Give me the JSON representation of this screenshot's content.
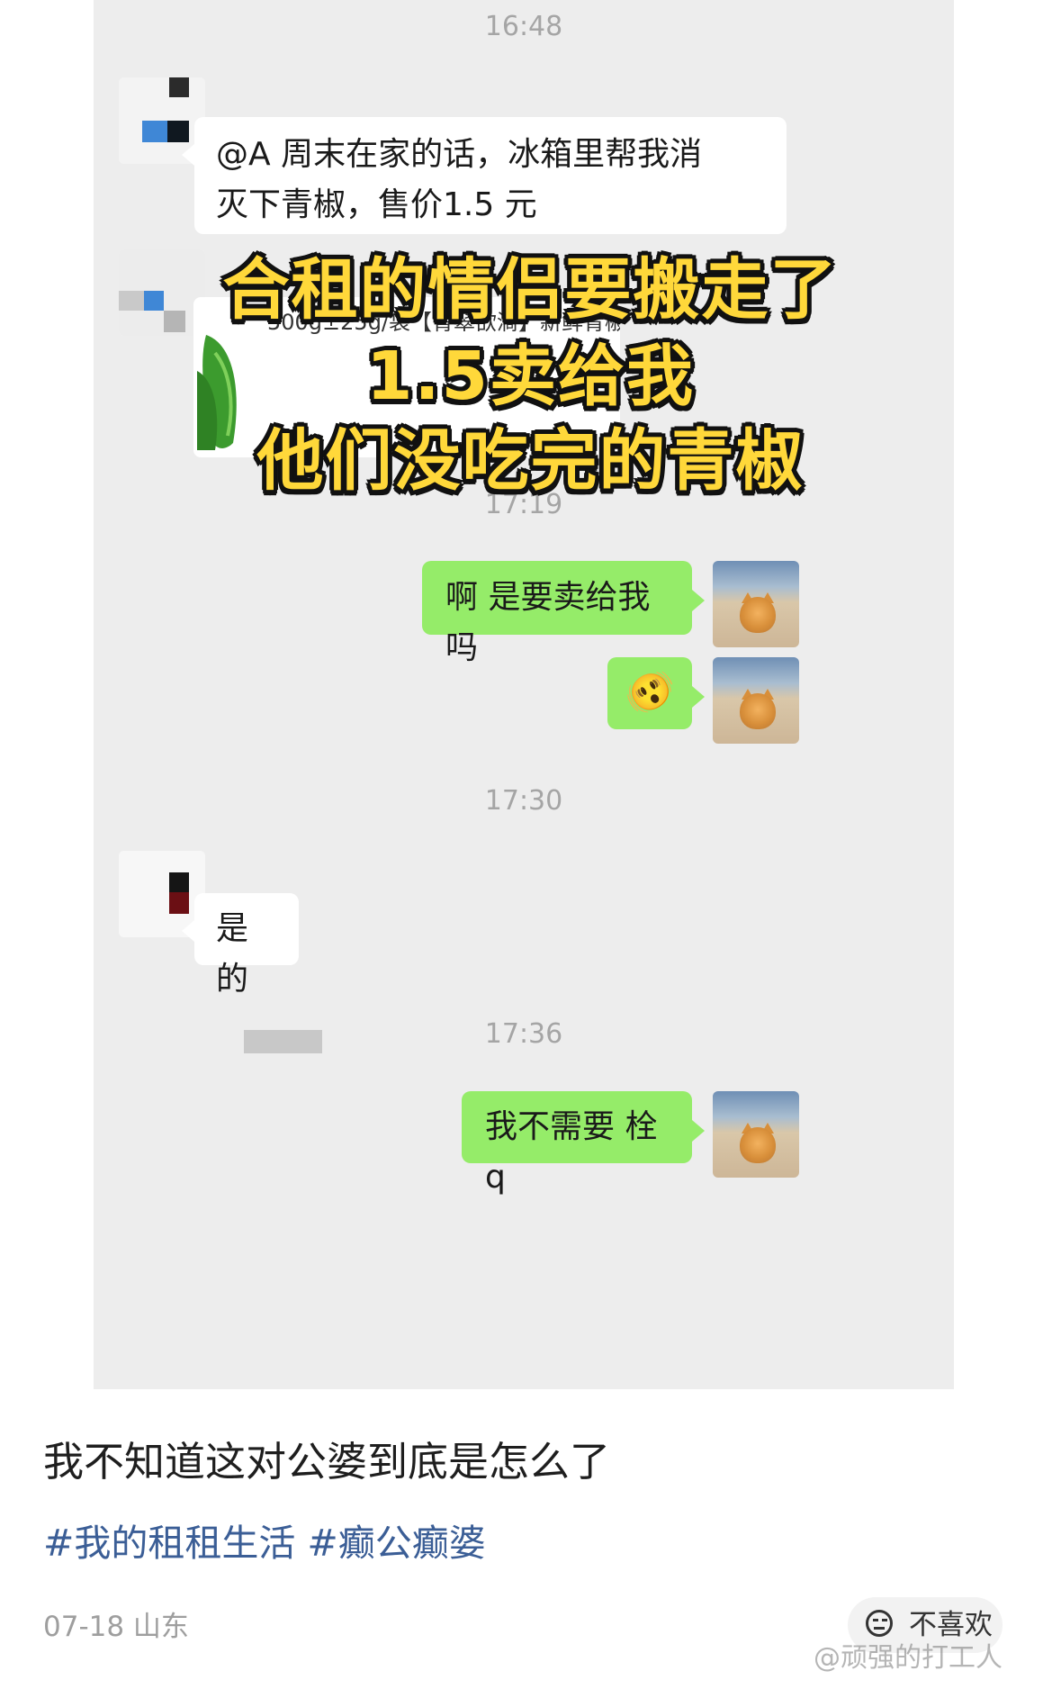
{
  "chat": {
    "timestamps": [
      "16:48",
      "17:19",
      "17:30",
      "17:36"
    ],
    "messages": [
      {
        "side": "in",
        "text_line1": "@A  周末在家的话，冰箱里帮我消",
        "text_line2": "灭下青椒，售价1.5 元"
      },
      {
        "side": "in",
        "product_title": "500g±25g/袋【青翠欲滴】新鲜青椒"
      },
      {
        "side": "out",
        "text": "啊 是要卖给我吗"
      },
      {
        "side": "out",
        "emoji": "🫨"
      },
      {
        "side": "in",
        "text": "是的"
      },
      {
        "side": "out",
        "text": "我不需要 栓 q"
      }
    ]
  },
  "overlay": {
    "line1": "合租的情侣要搬走了",
    "line2": "1.5卖给我",
    "line3": "他们没吃完的青椒",
    "color": "#ffd83a"
  },
  "post": {
    "caption": "我不知道这对公婆到底是怎么了",
    "tags": "#我的租租生活 #癫公癫婆",
    "date_location": "07-18 山东",
    "dislike_label": "不喜欢",
    "watermark": "@顽强的打工人"
  },
  "colors": {
    "chat_bg": "#ededed",
    "outgoing_bubble": "#95ec69",
    "incoming_bubble": "#ffffff",
    "tag_link": "#3b5e96"
  }
}
